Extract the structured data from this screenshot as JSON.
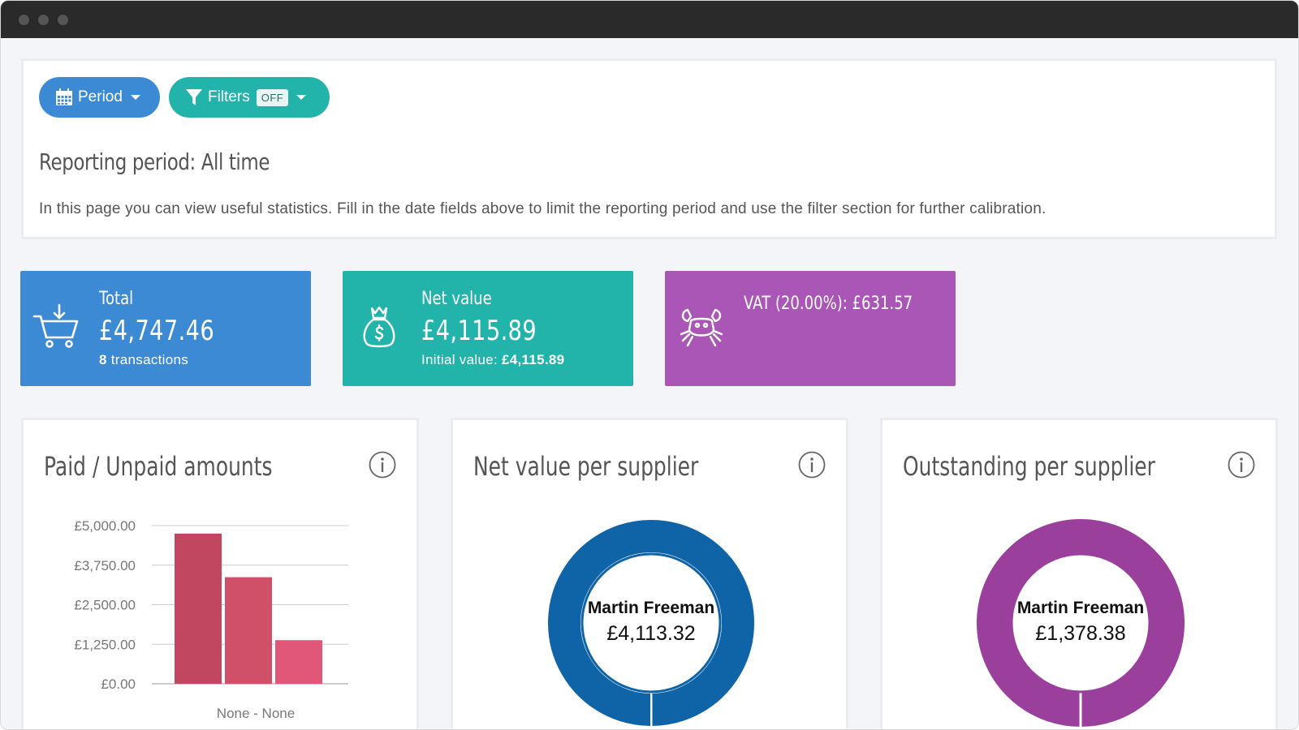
{
  "toolbar": {
    "period_label": "Period",
    "filters_label": "Filters",
    "filters_state": "OFF"
  },
  "header": {
    "title": "Reporting period: All time",
    "description": "In this page you can view useful statistics. Fill in the date fields above to limit the reporting period and use the filter section for further calibration."
  },
  "stats": {
    "total": {
      "label": "Total",
      "value": "£4,747.46",
      "count": "8",
      "count_suffix": " transactions",
      "icon": "cart-icon"
    },
    "net": {
      "label": "Net value",
      "value": "£4,115.89",
      "sub_prefix": "Initial value: ",
      "sub_value": "£4,115.89",
      "icon": "money-bag-icon"
    },
    "vat": {
      "label": "VAT (20.00%): £631.57",
      "icon": "crab-icon"
    }
  },
  "colors": {
    "blue": "#3d8ad4",
    "teal": "#22b4aa",
    "purple": "#aa56b6",
    "donut_blue": "#0f64a8",
    "donut_purple": "#9b3f9c"
  },
  "cards": {
    "paid_unpaid": {
      "title": "Paid / Unpaid amounts"
    },
    "net_supplier": {
      "title": "Net value per supplier",
      "center_name": "Martin Freeman",
      "center_value": "£4,113.32"
    },
    "outstanding_supplier": {
      "title": "Outstanding per supplier",
      "center_name": "Martin Freeman",
      "center_value": "£1,378.38"
    }
  },
  "chart_data": [
    {
      "type": "bar",
      "title": "Paid / Unpaid amounts",
      "categories": [
        "None - None"
      ],
      "series": [
        {
          "values": [
            4747.46
          ],
          "color": "#c0475f"
        },
        {
          "values": [
            3369.08
          ],
          "color": "#d0506a"
        },
        {
          "values": [
            1378.38
          ],
          "color": "#e0577a"
        }
      ],
      "yticks": [
        "£0.00",
        "£1,250.00",
        "£2,500.00",
        "£3,750.00",
        "£5,000.00"
      ],
      "ylim": [
        0,
        5000
      ],
      "grid": true
    },
    {
      "type": "pie",
      "title": "Net value per supplier",
      "slices": [
        {
          "label": "Martin Freeman",
          "value": 4113.32,
          "color": "#0f64a8"
        },
        {
          "label": "",
          "value": 2.57,
          "color": "#ffffff"
        }
      ]
    },
    {
      "type": "pie",
      "title": "Outstanding per supplier",
      "slices": [
        {
          "label": "Martin Freeman",
          "value": 1378.38,
          "color": "#9b3f9c"
        }
      ]
    }
  ]
}
